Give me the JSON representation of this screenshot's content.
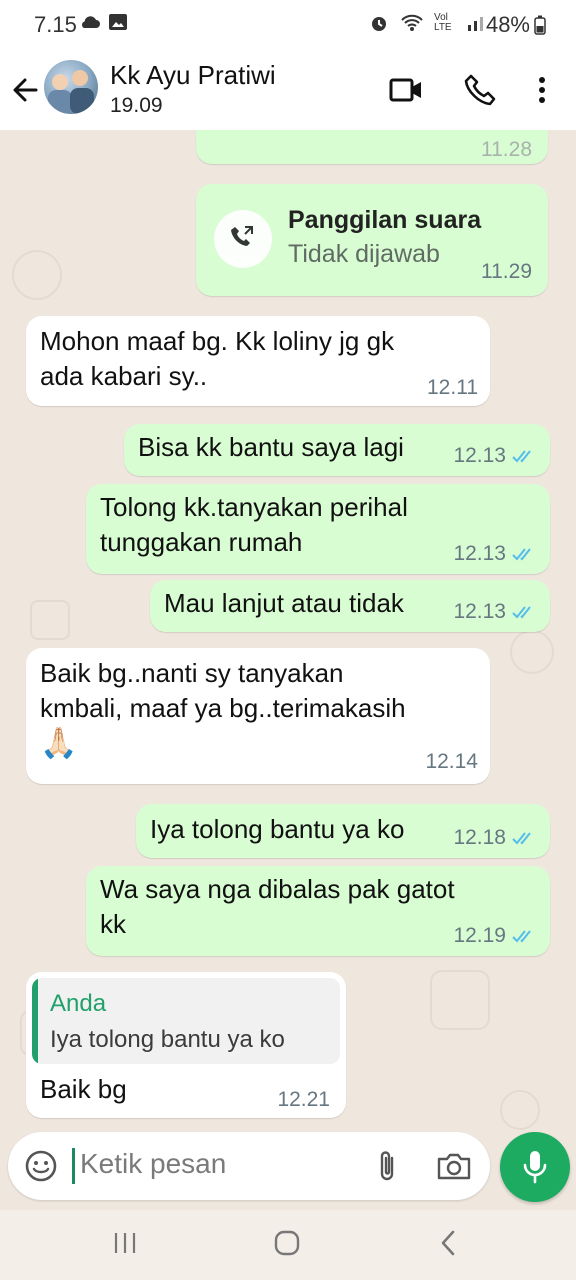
{
  "status_bar": {
    "time": "7.15",
    "battery": "48%",
    "volte": "Vol LTE"
  },
  "header": {
    "contact_name": "Kk Ayu Pratiwi",
    "last_seen": "19.09"
  },
  "colors": {
    "outgoing": "#d9fdd3",
    "incoming": "#ffffff",
    "accent": "#1daa61",
    "ticks": "#53bdeb"
  },
  "messages": [
    {
      "type": "call",
      "direction": "out",
      "title": "Panggilan suara",
      "subtitle": "Tidak dijawab",
      "time": "11.29"
    },
    {
      "direction": "in",
      "text": "Mohon maaf bg. Kk loliny jg gk\nada kabari sy..",
      "time": "12.11"
    },
    {
      "direction": "out",
      "text": "Bisa kk bantu saya lagi",
      "time": "12.13",
      "read": true
    },
    {
      "direction": "out",
      "text": "Tolong kk.tanyakan perihal\ntunggakan rumah",
      "time": "12.13",
      "read": true
    },
    {
      "direction": "out",
      "text": "Mau lanjut atau tidak",
      "time": "12.13",
      "read": true
    },
    {
      "direction": "in",
      "text": "Baik bg..nanti sy tanyakan\nkmbali, maaf ya bg..terimakasih",
      "emoji": "🙏🏻",
      "time": "12.14"
    },
    {
      "direction": "out",
      "text": "Iya tolong bantu ya ko",
      "time": "12.18",
      "read": true
    },
    {
      "direction": "out",
      "text": "Wa saya nga dibalas pak gatot\nkk",
      "time": "12.19",
      "read": true
    },
    {
      "direction": "in",
      "quote_author": "Anda",
      "quote_text": "Iya tolong bantu ya ko",
      "text": "Baik bg",
      "time": "12.21"
    }
  ],
  "input": {
    "placeholder": "Ketik pesan"
  },
  "icons": [
    "back-arrow-icon",
    "video-call-icon",
    "voice-call-icon",
    "more-options-icon",
    "missed-call-icon",
    "read-ticks-icon",
    "emoji-icon",
    "attach-icon",
    "camera-icon",
    "mic-icon",
    "recents-nav-icon",
    "home-nav-icon",
    "back-nav-icon"
  ]
}
